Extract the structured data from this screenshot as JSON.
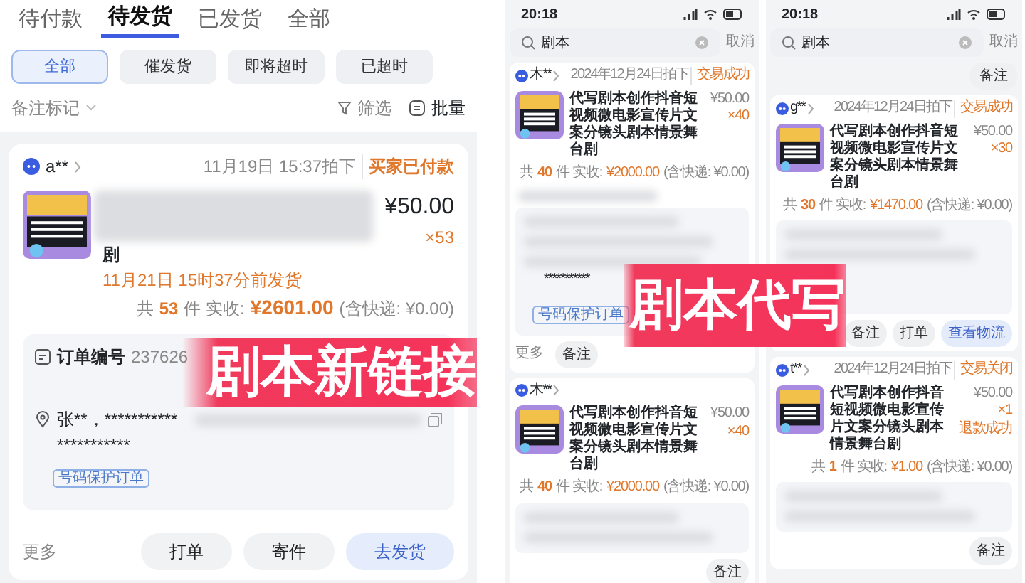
{
  "left": {
    "tabs": [
      {
        "label": "待付款",
        "selected": false
      },
      {
        "label": "待发货",
        "selected": true
      },
      {
        "label": "已发货",
        "selected": false
      },
      {
        "label": "全部",
        "selected": false
      }
    ],
    "chips": [
      {
        "label": "全部",
        "selected": true
      },
      {
        "label": "催发货",
        "selected": false
      },
      {
        "label": "即将超时",
        "selected": false
      },
      {
        "label": "已超时",
        "selected": false
      }
    ],
    "remark_filter": "备注标记",
    "filter": "筛选",
    "batch": "批量",
    "order": {
      "buyer": "a**",
      "time": "11月19日 15:37拍下",
      "status": "买家已付款",
      "title_tail": "剧",
      "price": "¥50.00",
      "qty": "×53",
      "ship_by": "11月21日 15时37分前发货",
      "count_prefix": "共",
      "count": "53",
      "count_suffix": "件 实收:",
      "amount": "¥2601.00",
      "shipping": "(含快递: ¥0.00)",
      "order_no_label": "订单编号",
      "order_no": "237626",
      "address": "张**，***********",
      "address2": "***********",
      "tag": "号码保护订单",
      "more": "更多",
      "buttons": [
        {
          "label": "打单",
          "primary": false
        },
        {
          "label": "寄件",
          "primary": false
        },
        {
          "label": "去发货",
          "primary": true
        }
      ]
    }
  },
  "phones": [
    {
      "time": "20:18",
      "search": "剧本",
      "cancel": "取消",
      "orders": [
        {
          "buyer": "木**",
          "date": "2024年12月24日拍下",
          "status": "交易成功",
          "title": "代写剧本创作抖音短视频微电影宣传片文案分镜头剧本情景舞台剧",
          "price": "¥50.00",
          "qty": "×40",
          "count_prefix": "共",
          "count": "40",
          "count_suffix": "件 实收:",
          "amount": "¥2000.00",
          "shipping": "(含快递: ¥0.00)",
          "masked": "***********",
          "tag": "号码保护订单",
          "more": "更多",
          "buttons": [
            {
              "label": "备注",
              "primary": false
            }
          ]
        },
        {
          "buyer": "木**",
          "title": "代写剧本创作抖音短视频微电影宣传片文案分镜头剧本情景舞台剧",
          "price": "¥50.00",
          "qty": "×40",
          "count_prefix": "共",
          "count": "40",
          "count_suffix": "件 实收:",
          "amount": "¥2000.00",
          "shipping": "(含快递: ¥0.00)",
          "buttons": [
            {
              "label": "备注",
              "primary": false
            }
          ]
        }
      ]
    },
    {
      "time": "20:18",
      "search": "剧本",
      "cancel": "取消",
      "top_buttons": [
        "备注"
      ],
      "orders": [
        {
          "buyer": "g**",
          "date": "2024年12月24日拍下",
          "status": "交易成功",
          "title": "代写剧本创作抖音短视频微电影宣传片文案分镜头剧本情景舞台剧",
          "price": "¥50.00",
          "qty": "×30",
          "count_prefix": "共",
          "count": "30",
          "count_suffix": "件 实收:",
          "amount": "¥1470.00",
          "shipping": "(含快递: ¥0.00)",
          "buttons": [
            {
              "label": "备注",
              "primary": false
            },
            {
              "label": "打单",
              "primary": false
            },
            {
              "label": "查看物流",
              "primary": true
            }
          ]
        },
        {
          "buyer": "t**",
          "date": "2024年12月24日拍下",
          "status": "交易关闭",
          "title": "代写剧本创作抖音短视频微电影宣传片文案分镜头剧本情景舞台剧",
          "price": "¥50.00",
          "qty": "×1",
          "refund": "退款成功",
          "count_prefix": "共",
          "count": "1",
          "count_suffix": "件 实收:",
          "amount": "¥1.00",
          "shipping": "(含快递: ¥0.00)",
          "buttons": [
            {
              "label": "备注",
              "primary": false
            }
          ]
        }
      ]
    }
  ],
  "banners": [
    "剧本新链接",
    "剧本代写"
  ]
}
